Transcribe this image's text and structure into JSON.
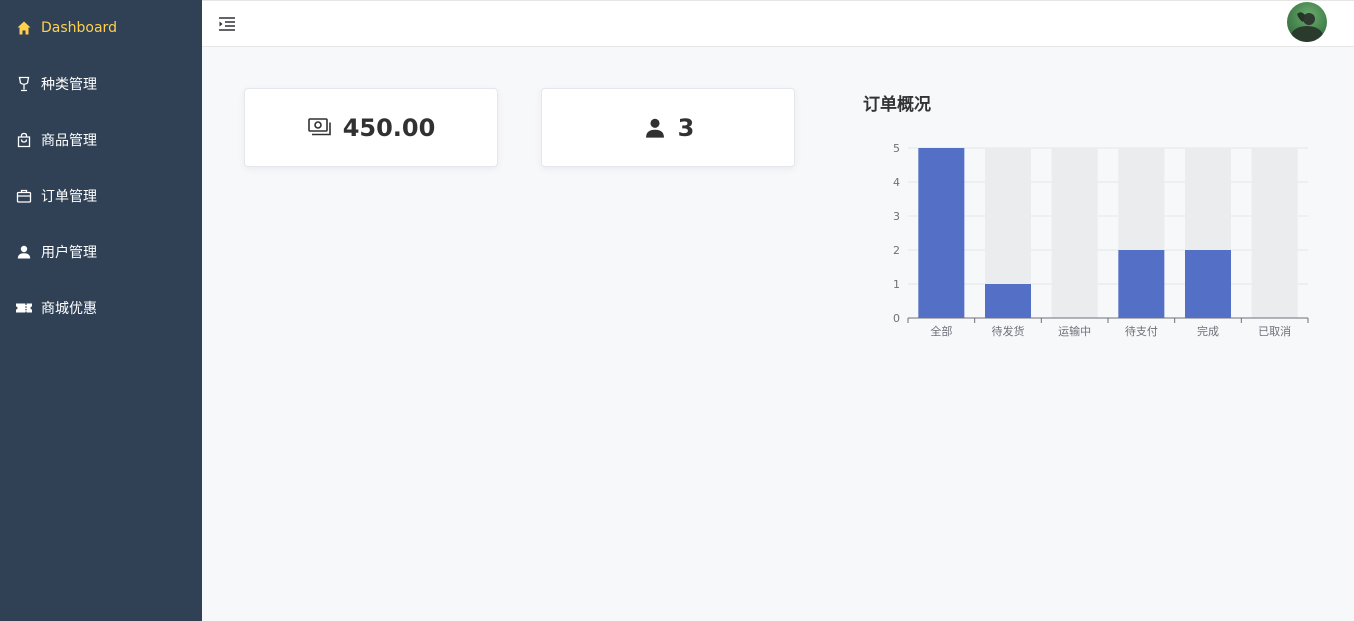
{
  "sidebar": {
    "items": [
      {
        "label": "Dashboard",
        "icon": "home-icon",
        "active": true
      },
      {
        "label": "种类管理",
        "icon": "goblet-icon",
        "active": false
      },
      {
        "label": "商品管理",
        "icon": "shopping-bag-icon",
        "active": false
      },
      {
        "label": "订单管理",
        "icon": "briefcase-icon",
        "active": false
      },
      {
        "label": "用户管理",
        "icon": "user-icon",
        "active": false
      },
      {
        "label": "商城优惠",
        "icon": "ticket-icon",
        "active": false
      }
    ]
  },
  "header": {
    "fold_icon": "menu-fold-icon",
    "avatar": "user-avatar"
  },
  "stats": [
    {
      "icon": "money-icon",
      "value": "450.00"
    },
    {
      "icon": "user-icon",
      "value": "3"
    }
  ],
  "chart_title": "订单概况",
  "chart_data": {
    "type": "bar",
    "title": "订单概况",
    "categories": [
      "全部",
      "待发货",
      "运输中",
      "待支付",
      "完成",
      "已取消"
    ],
    "values": [
      5,
      1,
      0,
      2,
      2,
      0
    ],
    "ylim": [
      0,
      5
    ],
    "yticks": [
      0,
      1,
      2,
      3,
      4,
      5
    ],
    "background_bars": true,
    "colors": {
      "bar": "#5470c6",
      "background": "#ebecee",
      "grid": "#e6e6e6"
    },
    "grid": true
  },
  "colors": {
    "sidebar_bg": "#304156",
    "active_text": "#ffd04b",
    "menu_text": "#ffffff"
  }
}
